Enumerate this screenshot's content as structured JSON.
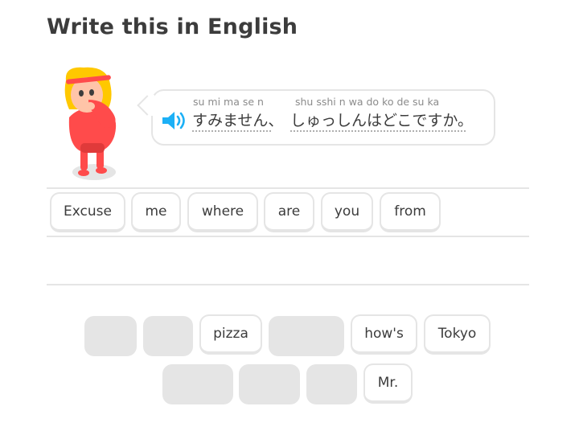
{
  "header": {
    "title": "Write this in English"
  },
  "prompt": {
    "tokens": [
      {
        "romaji": "su mi ma se  n",
        "kana": "すみません、"
      },
      {
        "romaji": "shu   sshi   n  wa do ko de su ka",
        "kana": "しゅっしんはどこですか。"
      }
    ]
  },
  "answer": {
    "words": [
      "Excuse",
      "me",
      "where",
      "are",
      "you",
      "from"
    ]
  },
  "word_bank": {
    "words": [
      "pizza",
      "how's",
      "Tokyo",
      "Mr."
    ]
  },
  "colors": {
    "accent_blue": "#1cb0f6",
    "border": "#e5e5e5",
    "text": "#3c3c3c"
  },
  "icons": {
    "speaker": "speaker-icon",
    "character": "lily-character"
  }
}
